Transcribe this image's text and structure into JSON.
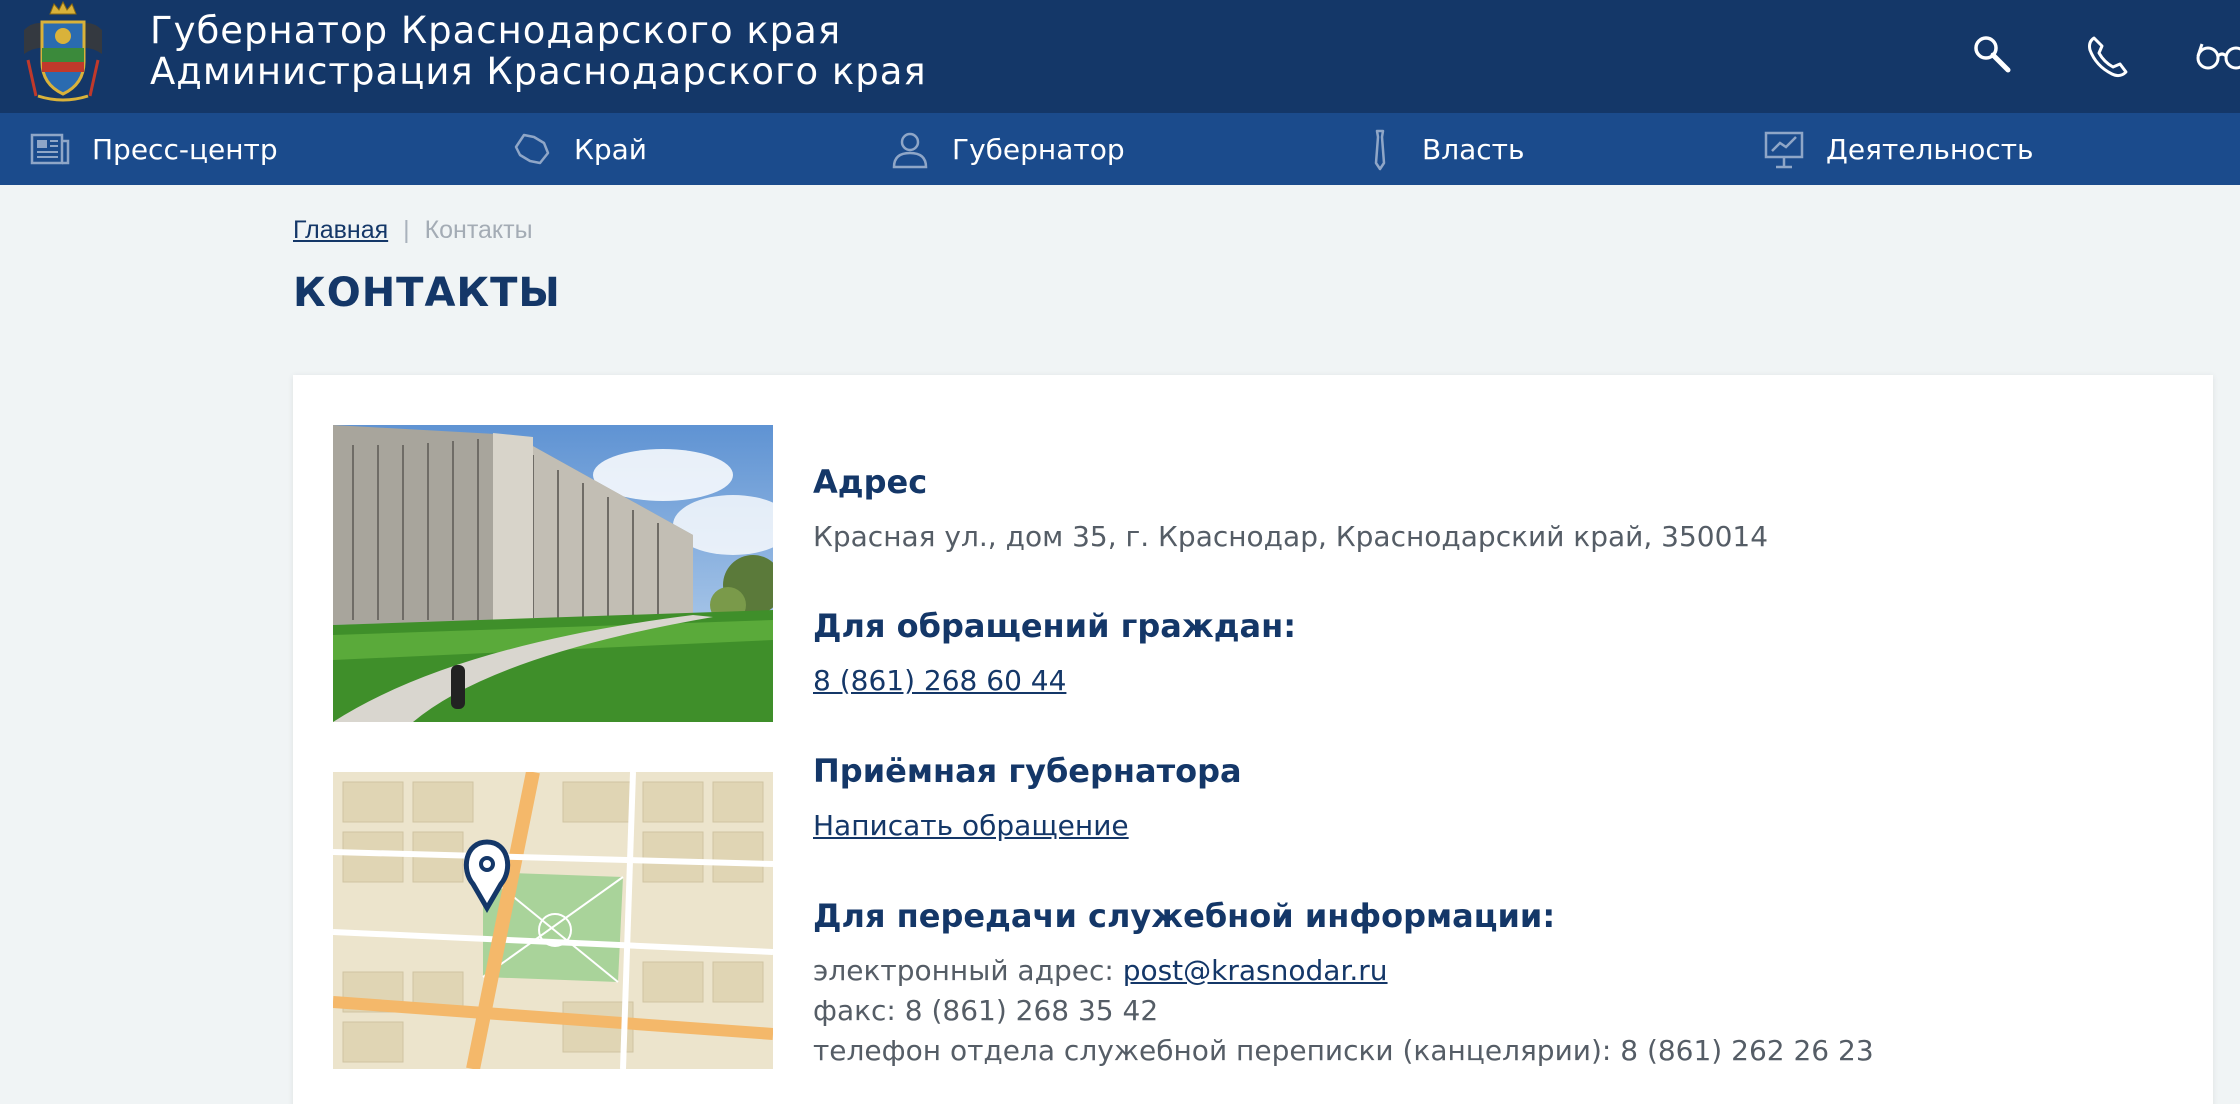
{
  "header": {
    "title_line1": "Губернатор Краснодарского края",
    "title_line2": "Администрация Краснодарского края",
    "tools": [
      {
        "icon": "search-icon"
      },
      {
        "icon": "phone-icon"
      },
      {
        "icon": "glasses-icon"
      }
    ]
  },
  "nav": {
    "items": [
      {
        "label": "Пресс-центр",
        "icon": "newspaper-icon"
      },
      {
        "label": "Край",
        "icon": "region-map-icon"
      },
      {
        "label": "Губернатор",
        "icon": "person-icon"
      },
      {
        "label": "Власть",
        "icon": "tie-icon"
      },
      {
        "label": "Деятельность",
        "icon": "presentation-icon"
      }
    ]
  },
  "breadcrumb": {
    "home": "Главная",
    "separator": "|",
    "current": "Контакты"
  },
  "page_title": "КОНТАКТЫ",
  "contacts": {
    "address_heading": "Адрес",
    "address_text": "Красная ул., дом 35, г. Краснодар, Краснодарский край, 350014",
    "citizens_heading": "Для обращений граждан:",
    "citizens_phone": "8 (861) 268 60 44",
    "reception_heading": "Приёмная губернатора",
    "reception_link": "Написать обращение",
    "service_heading": "Для передачи служебной информации:",
    "email_label": "электронный адрес: ",
    "email": "post@krasnodar.ru",
    "fax": "факс: 8 (861) 268 35 42",
    "chancellery_phone": "телефон отдела служебной переписки (канцелярии): 8 (861) 262 26 23"
  },
  "colors": {
    "header_bg": "#143768",
    "nav_bg": "#1b4b8c",
    "accent": "#143768",
    "page_bg": "#f0f4f5"
  }
}
